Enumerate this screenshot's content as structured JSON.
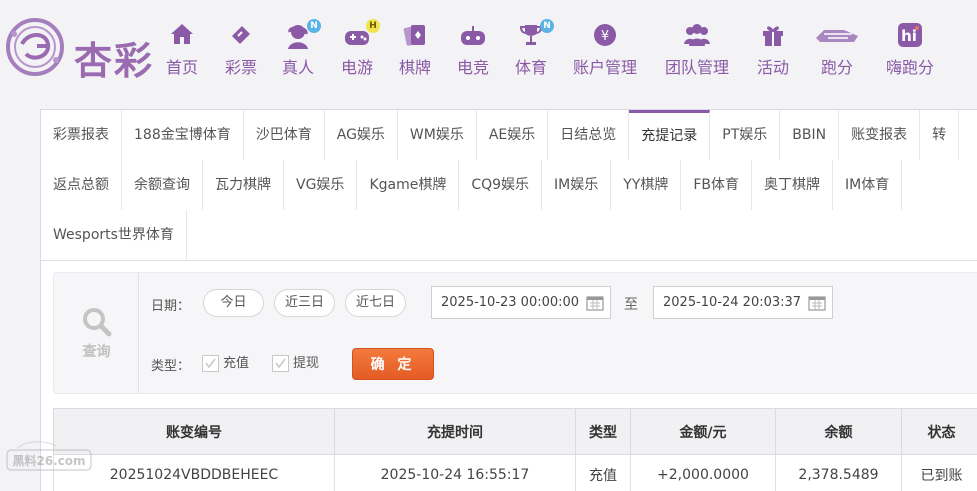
{
  "brand": {
    "name": "杏彩"
  },
  "nav": [
    {
      "label": "首页",
      "icon": "home-icon",
      "badge": ""
    },
    {
      "label": "彩票",
      "icon": "lottery-icon",
      "badge": ""
    },
    {
      "label": "真人",
      "icon": "live-dealer-icon",
      "badge": "N"
    },
    {
      "label": "电游",
      "icon": "gamepad-icon",
      "badge": "H"
    },
    {
      "label": "棋牌",
      "icon": "cards-icon",
      "badge": ""
    },
    {
      "label": "电竞",
      "icon": "esports-icon",
      "badge": ""
    },
    {
      "label": "体育",
      "icon": "trophy-icon",
      "badge": "N"
    },
    {
      "label": "账户管理",
      "icon": "account-icon",
      "badge": ""
    },
    {
      "label": "团队管理",
      "icon": "team-icon",
      "badge": ""
    },
    {
      "label": "活动",
      "icon": "gift-icon",
      "badge": ""
    },
    {
      "label": "跑分",
      "icon": "running-icon",
      "badge": ""
    },
    {
      "label": "嗨跑分",
      "icon": "hi-icon",
      "badge": ""
    }
  ],
  "tabs_row1": [
    "彩票报表",
    "188金宝博体育",
    "沙巴体育",
    "AG娱乐",
    "WM娱乐",
    "AE娱乐",
    "日结总览",
    "充提记录",
    "PT娱乐",
    "BBIN",
    "账变报表",
    "转"
  ],
  "tabs_row2": [
    "返点总额",
    "余额查询",
    "瓦力棋牌",
    "VG娱乐",
    "Kgame棋牌",
    "CQ9娱乐",
    "IM娱乐",
    "YY棋牌",
    "FB体育",
    "奥丁棋牌",
    "IM体育"
  ],
  "tabs_row3": [
    "Wesports世界体育"
  ],
  "active_tab": "充提记录",
  "query": {
    "side_label": "查询",
    "date_label": "日期：",
    "quick": [
      "今日",
      "近三日",
      "近七日"
    ],
    "date_from": "2025-10-23 00:00:00",
    "to_label": "至",
    "date_to": "2025-10-24 20:03:37",
    "type_label": "类型：",
    "types": [
      "充值",
      "提现"
    ],
    "confirm": "确 定"
  },
  "table": {
    "headers": [
      "账变编号",
      "充提时间",
      "类型",
      "金额/元",
      "余额",
      "状态"
    ],
    "rows": [
      [
        "20251024VBDDBEHEEC",
        "2025-10-24 16:55:17",
        "充值",
        "+2,000.0000",
        "2,378.5489",
        "已到账"
      ]
    ]
  },
  "colors": {
    "brand": "#8a5aa6",
    "confirm": "#e8652b",
    "amount": "#e0322d",
    "status_ok": "#3ea12a"
  },
  "watermark": "黑料26.com"
}
